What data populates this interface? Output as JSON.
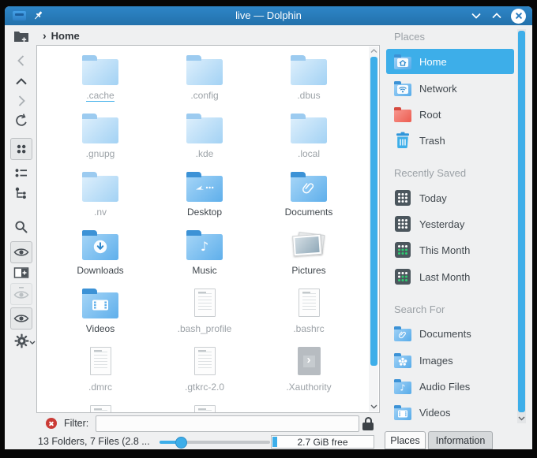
{
  "titlebar": {
    "title": "live — Dolphin"
  },
  "breadcrumb": {
    "chevron": "›",
    "root_label": "Home"
  },
  "toolbar": {
    "icons": [
      "create-new-folder",
      "go-back",
      "go-up",
      "go-forward",
      "refresh",
      "icons-view-mode",
      "compact-view-mode",
      "details-view-mode",
      "search",
      "show-preview",
      "split-view",
      "hidden-files-dimmed",
      "show-hidden-files",
      "settings-menu"
    ]
  },
  "files": {
    "items": [
      {
        "name": ".cache",
        "icon": "folder-hidden",
        "underlined": true
      },
      {
        "name": ".config",
        "icon": "folder-hidden"
      },
      {
        "name": ".dbus",
        "icon": "folder-hidden"
      },
      {
        "name": ".gnupg",
        "icon": "folder-hidden"
      },
      {
        "name": ".kde",
        "icon": "folder-hidden"
      },
      {
        "name": ".local",
        "icon": "folder-hidden"
      },
      {
        "name": ".nv",
        "icon": "folder-hidden"
      },
      {
        "name": "Desktop",
        "icon": "folder-desktop"
      },
      {
        "name": "Documents",
        "icon": "folder-documents"
      },
      {
        "name": "Downloads",
        "icon": "folder-downloads"
      },
      {
        "name": "Music",
        "icon": "folder-music"
      },
      {
        "name": "Pictures",
        "icon": "photo-stack"
      },
      {
        "name": "Videos",
        "icon": "folder-videos"
      },
      {
        "name": ".bash_profile",
        "icon": "text-file"
      },
      {
        "name": ".bashrc",
        "icon": "text-file"
      },
      {
        "name": ".dmrc",
        "icon": "text-file"
      },
      {
        "name": ".gtkrc-2.0",
        "icon": "text-file"
      },
      {
        "name": ".Xauthority",
        "icon": "binary-file"
      }
    ],
    "partial_next_row_icons": 2
  },
  "sidebar": {
    "sections": [
      {
        "header": "Places",
        "items": [
          {
            "label": "Home",
            "icon": "folder-home",
            "selected": true
          },
          {
            "label": "Network",
            "icon": "folder-network",
            "selected": false
          },
          {
            "label": "Root",
            "icon": "folder-root",
            "selected": false
          },
          {
            "label": "Trash",
            "icon": "trash-can",
            "selected": false
          }
        ]
      },
      {
        "header": "Recently Saved",
        "items": [
          {
            "label": "Today",
            "icon": "calendar"
          },
          {
            "label": "Yesterday",
            "icon": "calendar"
          },
          {
            "label": "This Month",
            "icon": "calendar-green"
          },
          {
            "label": "Last Month",
            "icon": "calendar-green"
          }
        ]
      },
      {
        "header": "Search For",
        "items": [
          {
            "label": "Documents",
            "icon": "folder-documents"
          },
          {
            "label": "Images",
            "icon": "folder-images"
          },
          {
            "label": "Audio Files",
            "icon": "folder-audio"
          },
          {
            "label": "Videos",
            "icon": "folder-videos"
          }
        ]
      }
    ],
    "tabs": [
      {
        "label": "Places",
        "active": true
      },
      {
        "label": "Information",
        "active": false
      }
    ]
  },
  "filter": {
    "label": "Filter:",
    "value": ""
  },
  "statusbar": {
    "items_summary": "13 Folders, 7 Files (2.8 ...",
    "free_space_label": "2.7 GiB free"
  },
  "glyphs": {
    "music_note": "♪",
    "binary_chevron": "›",
    "breadcrumb_chevron": "›"
  },
  "colors": {
    "accent": "#3daee9",
    "titlebar": "#2980b9",
    "window_bg": "#eff0f1",
    "folder_blue": "#5fafeb",
    "text": "#31363b",
    "hidden_text": "#9da3a8"
  }
}
